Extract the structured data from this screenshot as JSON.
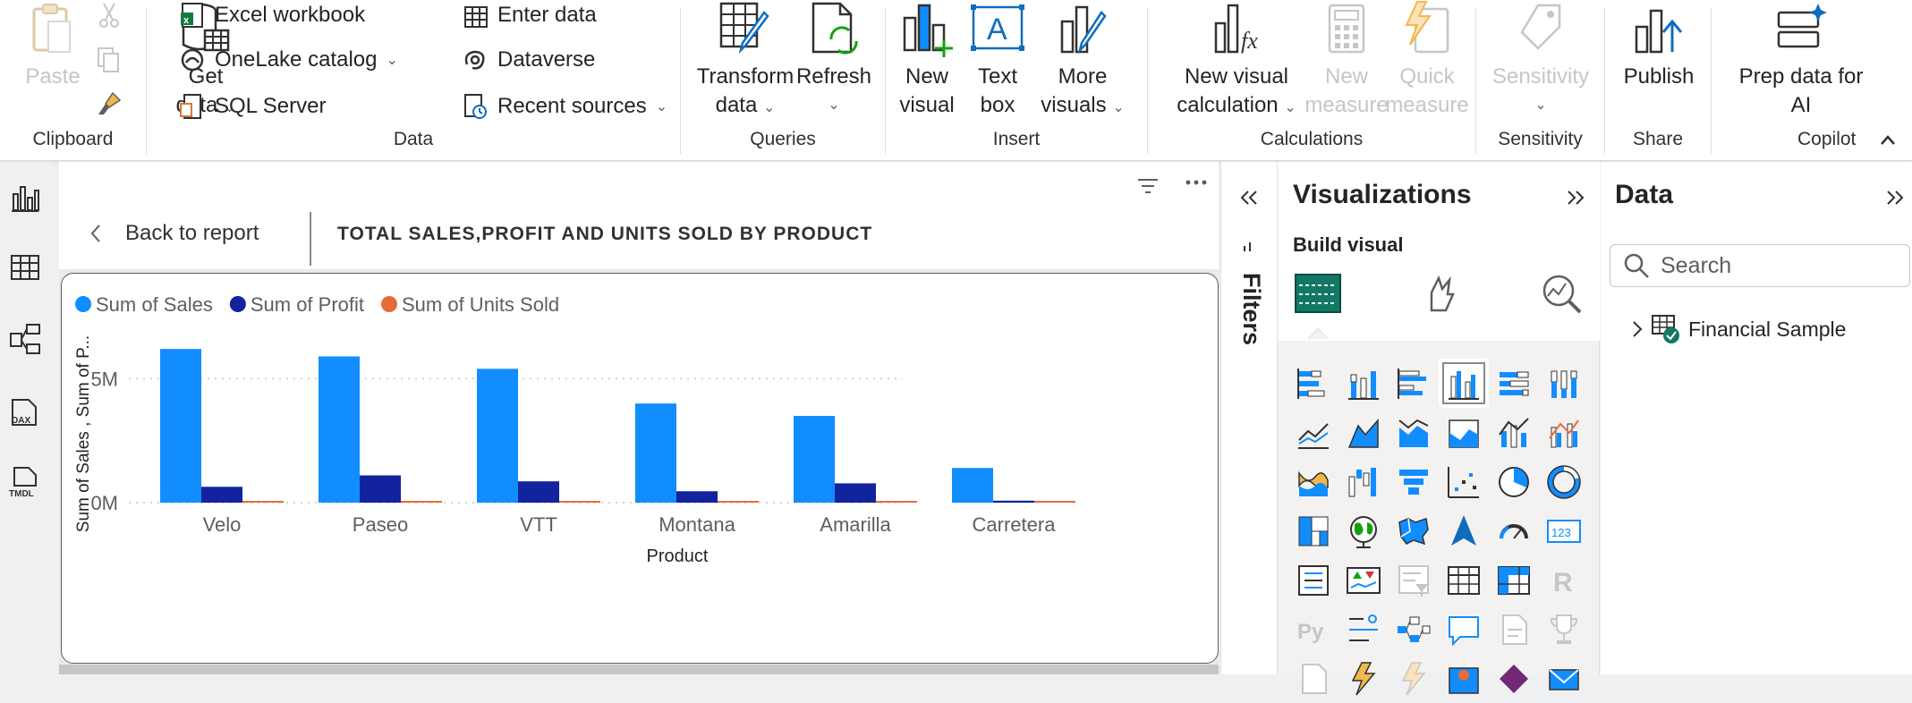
{
  "ribbon": {
    "clipboard": {
      "paste": "Paste",
      "label": "Clipboard"
    },
    "data": {
      "get_data": "Get",
      "get_data_2": "data",
      "excel": "Excel workbook",
      "onelake": "OneLake catalog",
      "sql": "SQL Server",
      "enter_data": "Enter data",
      "dataverse": "Dataverse",
      "recent": "Recent sources",
      "label": "Data"
    },
    "queries": {
      "transform": "Transform",
      "transform_2": "data",
      "refresh": "Refresh",
      "label": "Queries"
    },
    "insert": {
      "new_visual": "New",
      "new_visual_2": "visual",
      "text_box": "Text",
      "text_box_2": "box",
      "more_visuals": "More",
      "more_visuals_2": "visuals",
      "label": "Insert"
    },
    "calculations": {
      "new_visual_calc": "New visual",
      "new_visual_calc_2": "calculation",
      "new_measure": "New",
      "new_measure_2": "measure",
      "quick_measure": "Quick",
      "quick_measure_2": "measure",
      "label": "Calculations"
    },
    "sensitivity": {
      "button": "Sensitivity",
      "label": "Sensitivity"
    },
    "share": {
      "publish": "Publish",
      "label": "Share"
    },
    "copilot": {
      "prep": "Prep data for",
      "prep_2": "AI",
      "label": "Copilot"
    }
  },
  "canvas": {
    "back_label": "Back to report",
    "title": "TOTAL SALES,PROFIT AND UNITS SOLD BY PRODUCT"
  },
  "filters": {
    "label": "Filters"
  },
  "visualizations": {
    "title": "Visualizations",
    "subtitle": "Build visual"
  },
  "data_pane": {
    "title": "Data",
    "search_placeholder": "Search",
    "table_name": "Financial Sample"
  },
  "colors": {
    "sales": "#118DFF",
    "profit": "#12239E",
    "units": "#E66C37",
    "accent": "#117865"
  },
  "chart_data": {
    "type": "bar",
    "categories": [
      "Velo",
      "Paseo",
      "VTT",
      "Montana",
      "Amarilla",
      "Carretera"
    ],
    "series": [
      {
        "name": "Sum of   Sales",
        "values": [
          6.2,
          5.9,
          5.4,
          4.0,
          3.5,
          1.4
        ]
      },
      {
        "name": "Sum of  Profit",
        "values": [
          0.64,
          1.1,
          0.86,
          0.46,
          0.78,
          0.08
        ]
      },
      {
        "name": "Sum of Units Sold",
        "values": [
          0.05,
          0.07,
          0.05,
          0.04,
          0.05,
          0.03
        ]
      }
    ],
    "yticks": [
      "0M",
      "5M"
    ],
    "ylim": [
      0,
      7
    ],
    "xlabel": "Product",
    "ylabel": "Sum of Sales , Sum of P...",
    "legend": "top-left",
    "grid": true
  }
}
